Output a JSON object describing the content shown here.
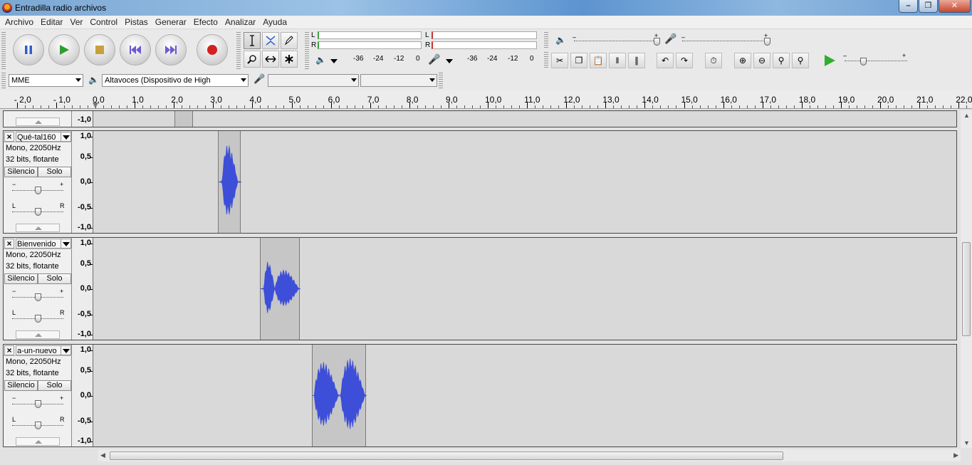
{
  "window": {
    "title": "Entradilla radio archivos"
  },
  "menu": [
    "Archivo",
    "Editar",
    "Ver",
    "Control",
    "Pistas",
    "Generar",
    "Efecto",
    "Analizar",
    "Ayuda"
  ],
  "meters": {
    "play_channels": [
      "L",
      "R"
    ],
    "record_channels": [
      "L",
      "R"
    ],
    "scale": [
      "-36",
      "-24",
      "-12",
      "0"
    ]
  },
  "device": {
    "host": "MME",
    "output": "Altavoces (Dispositivo de High",
    "input": "",
    "channels": ""
  },
  "timeline": {
    "labels": [
      "- 2,0",
      "- 1,0",
      "0,0",
      "1,0",
      "2,0",
      "3,0",
      "4,0",
      "5,0",
      "6,0",
      "7,0",
      "8,0",
      "9,0",
      "10,0",
      "11,0",
      "12,0",
      "13,0",
      "14,0",
      "15,0",
      "16,0",
      "17,0",
      "18,0",
      "19,0",
      "20,0",
      "21,0",
      "22,0"
    ]
  },
  "top_partial_track": {
    "scale_bottom": "-1,0"
  },
  "track_common": {
    "mute": "Silencio",
    "solo": "Solo",
    "gain_minus": "−",
    "gain_plus": "+",
    "pan_left": "L",
    "pan_right": "R",
    "scale": [
      "1,0",
      "0,5",
      "0,0",
      "-0,5",
      "-1,0"
    ]
  },
  "tracks": [
    {
      "name": "Qué-tal160",
      "rate": "Mono, 22050Hz",
      "format": "32 bits, flotante"
    },
    {
      "name": "Bienvenido",
      "rate": "Mono, 22050Hz",
      "format": "32 bits, flotante"
    },
    {
      "name": "a-un-nuevo",
      "rate": "Mono, 22050Hz",
      "format": "32 bits, flotante"
    }
  ],
  "icons": {
    "pause": "pause-icon",
    "play": "play-icon",
    "stop": "stop-icon",
    "skip_start": "skip-start-icon",
    "skip_end": "skip-end-icon",
    "record": "record-icon",
    "selection_tool": "i-beam-icon",
    "envelope_tool": "envelope-icon",
    "draw_tool": "pencil-icon",
    "zoom_tool": "magnifier-icon",
    "timeshift_tool": "double-arrow-icon",
    "multi_tool": "asterisk-icon"
  },
  "colors": {
    "waveform": "#3d4ed8",
    "clip_bg": "#c6c6c6",
    "track_bg": "#d9d9d9",
    "record": "#d42020",
    "play": "#2f9e2f"
  }
}
